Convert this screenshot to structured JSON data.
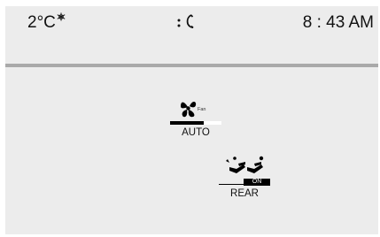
{
  "status_bar": {
    "temperature": "2°C",
    "temp_icon": "snowflake-icon",
    "signal_icon": "signal-dots-icon",
    "phone_icon": "phone-icon",
    "time": "8 : 43 AM"
  },
  "fan": {
    "icon": "fan-icon",
    "speed_text": "Fan",
    "level": 0.65,
    "label": "AUTO"
  },
  "rear": {
    "icon": "rear-seat-heat-icon",
    "status": "ON",
    "label": "REAR"
  }
}
